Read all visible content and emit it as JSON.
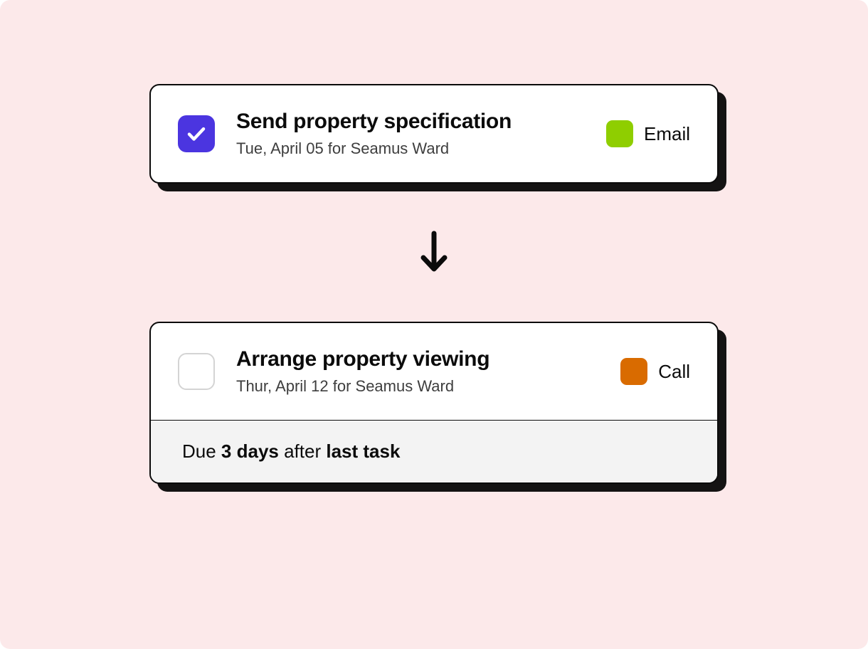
{
  "tasks": [
    {
      "title": "Send property specification",
      "subtitle": "Tue, April 05 for Seamus Ward",
      "completed": true,
      "tag": {
        "label": "Email",
        "color": "#8fce00"
      }
    },
    {
      "title": "Arrange property viewing",
      "subtitle": "Thur, April 12 for Seamus Ward",
      "completed": false,
      "tag": {
        "label": "Call",
        "color": "#d96b00"
      }
    }
  ],
  "due_rule": {
    "prefix": "Due ",
    "amount": "3 days",
    "middle": " after ",
    "anchor": "last task"
  },
  "colors": {
    "canvas_bg": "#fce9ea",
    "checkbox_checked": "#4b35e0"
  }
}
